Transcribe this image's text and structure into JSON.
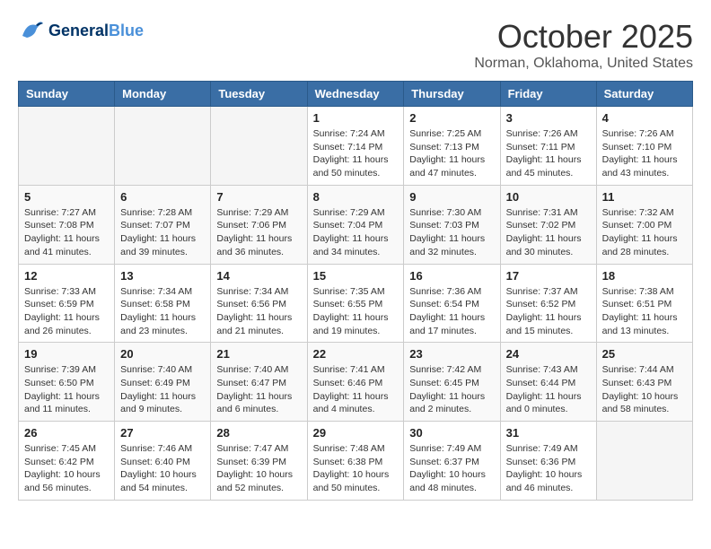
{
  "header": {
    "logo_line1": "General",
    "logo_line2": "Blue",
    "month_title": "October 2025",
    "location": "Norman, Oklahoma, United States"
  },
  "days_of_week": [
    "Sunday",
    "Monday",
    "Tuesday",
    "Wednesday",
    "Thursday",
    "Friday",
    "Saturday"
  ],
  "weeks": [
    [
      {
        "day": "",
        "info": ""
      },
      {
        "day": "",
        "info": ""
      },
      {
        "day": "",
        "info": ""
      },
      {
        "day": "1",
        "info": "Sunrise: 7:24 AM\nSunset: 7:14 PM\nDaylight: 11 hours\nand 50 minutes."
      },
      {
        "day": "2",
        "info": "Sunrise: 7:25 AM\nSunset: 7:13 PM\nDaylight: 11 hours\nand 47 minutes."
      },
      {
        "day": "3",
        "info": "Sunrise: 7:26 AM\nSunset: 7:11 PM\nDaylight: 11 hours\nand 45 minutes."
      },
      {
        "day": "4",
        "info": "Sunrise: 7:26 AM\nSunset: 7:10 PM\nDaylight: 11 hours\nand 43 minutes."
      }
    ],
    [
      {
        "day": "5",
        "info": "Sunrise: 7:27 AM\nSunset: 7:08 PM\nDaylight: 11 hours\nand 41 minutes."
      },
      {
        "day": "6",
        "info": "Sunrise: 7:28 AM\nSunset: 7:07 PM\nDaylight: 11 hours\nand 39 minutes."
      },
      {
        "day": "7",
        "info": "Sunrise: 7:29 AM\nSunset: 7:06 PM\nDaylight: 11 hours\nand 36 minutes."
      },
      {
        "day": "8",
        "info": "Sunrise: 7:29 AM\nSunset: 7:04 PM\nDaylight: 11 hours\nand 34 minutes."
      },
      {
        "day": "9",
        "info": "Sunrise: 7:30 AM\nSunset: 7:03 PM\nDaylight: 11 hours\nand 32 minutes."
      },
      {
        "day": "10",
        "info": "Sunrise: 7:31 AM\nSunset: 7:02 PM\nDaylight: 11 hours\nand 30 minutes."
      },
      {
        "day": "11",
        "info": "Sunrise: 7:32 AM\nSunset: 7:00 PM\nDaylight: 11 hours\nand 28 minutes."
      }
    ],
    [
      {
        "day": "12",
        "info": "Sunrise: 7:33 AM\nSunset: 6:59 PM\nDaylight: 11 hours\nand 26 minutes."
      },
      {
        "day": "13",
        "info": "Sunrise: 7:34 AM\nSunset: 6:58 PM\nDaylight: 11 hours\nand 23 minutes."
      },
      {
        "day": "14",
        "info": "Sunrise: 7:34 AM\nSunset: 6:56 PM\nDaylight: 11 hours\nand 21 minutes."
      },
      {
        "day": "15",
        "info": "Sunrise: 7:35 AM\nSunset: 6:55 PM\nDaylight: 11 hours\nand 19 minutes."
      },
      {
        "day": "16",
        "info": "Sunrise: 7:36 AM\nSunset: 6:54 PM\nDaylight: 11 hours\nand 17 minutes."
      },
      {
        "day": "17",
        "info": "Sunrise: 7:37 AM\nSunset: 6:52 PM\nDaylight: 11 hours\nand 15 minutes."
      },
      {
        "day": "18",
        "info": "Sunrise: 7:38 AM\nSunset: 6:51 PM\nDaylight: 11 hours\nand 13 minutes."
      }
    ],
    [
      {
        "day": "19",
        "info": "Sunrise: 7:39 AM\nSunset: 6:50 PM\nDaylight: 11 hours\nand 11 minutes."
      },
      {
        "day": "20",
        "info": "Sunrise: 7:40 AM\nSunset: 6:49 PM\nDaylight: 11 hours\nand 9 minutes."
      },
      {
        "day": "21",
        "info": "Sunrise: 7:40 AM\nSunset: 6:47 PM\nDaylight: 11 hours\nand 6 minutes."
      },
      {
        "day": "22",
        "info": "Sunrise: 7:41 AM\nSunset: 6:46 PM\nDaylight: 11 hours\nand 4 minutes."
      },
      {
        "day": "23",
        "info": "Sunrise: 7:42 AM\nSunset: 6:45 PM\nDaylight: 11 hours\nand 2 minutes."
      },
      {
        "day": "24",
        "info": "Sunrise: 7:43 AM\nSunset: 6:44 PM\nDaylight: 11 hours\nand 0 minutes."
      },
      {
        "day": "25",
        "info": "Sunrise: 7:44 AM\nSunset: 6:43 PM\nDaylight: 10 hours\nand 58 minutes."
      }
    ],
    [
      {
        "day": "26",
        "info": "Sunrise: 7:45 AM\nSunset: 6:42 PM\nDaylight: 10 hours\nand 56 minutes."
      },
      {
        "day": "27",
        "info": "Sunrise: 7:46 AM\nSunset: 6:40 PM\nDaylight: 10 hours\nand 54 minutes."
      },
      {
        "day": "28",
        "info": "Sunrise: 7:47 AM\nSunset: 6:39 PM\nDaylight: 10 hours\nand 52 minutes."
      },
      {
        "day": "29",
        "info": "Sunrise: 7:48 AM\nSunset: 6:38 PM\nDaylight: 10 hours\nand 50 minutes."
      },
      {
        "day": "30",
        "info": "Sunrise: 7:49 AM\nSunset: 6:37 PM\nDaylight: 10 hours\nand 48 minutes."
      },
      {
        "day": "31",
        "info": "Sunrise: 7:49 AM\nSunset: 6:36 PM\nDaylight: 10 hours\nand 46 minutes."
      },
      {
        "day": "",
        "info": ""
      }
    ]
  ]
}
